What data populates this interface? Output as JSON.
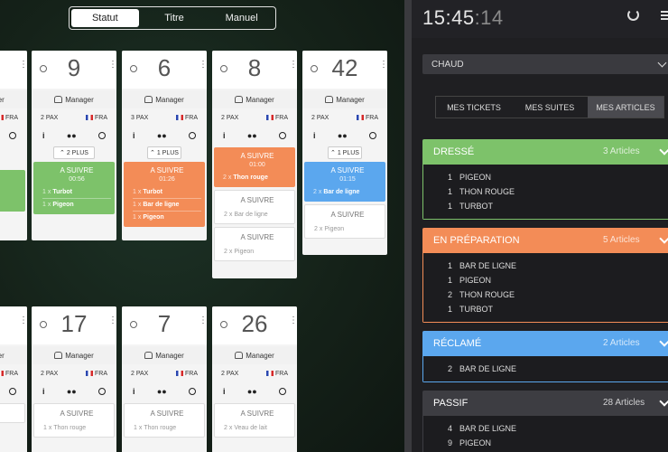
{
  "segmented": {
    "items": [
      "Statut",
      "Titre",
      "Manuel"
    ],
    "active": "Statut"
  },
  "clock": {
    "hm": "15:45",
    "sec": ":14"
  },
  "dropdown": {
    "value": "CHAUD"
  },
  "tabs": {
    "items": [
      "MES TICKETS",
      "MES SUITES",
      "MES ARTICLES"
    ],
    "active": "MES ARTICLES"
  },
  "common": {
    "manager": "Manager",
    "flag_label": "FRA",
    "info": "i",
    "menu_dots": "⋮"
  },
  "cards_row1": [
    {
      "num": "",
      "pax": "",
      "more": "",
      "blocks": [
        {
          "type": "green",
          "head": "",
          "time": "",
          "items": []
        }
      ]
    },
    {
      "num": "9",
      "pax": "2 PAX",
      "more": "2 PLUS",
      "blocks": [
        {
          "type": "green",
          "head": "A SUIVRE",
          "time": "00:56",
          "items": [
            {
              "q": "1 x",
              "n": "Turbot"
            },
            {
              "q": "1 x",
              "n": "Pigeon"
            }
          ]
        }
      ]
    },
    {
      "num": "6",
      "pax": "3 PAX",
      "more": "1 PLUS",
      "blocks": [
        {
          "type": "orange",
          "head": "A SUIVRE",
          "time": "01:26",
          "items": [
            {
              "q": "1 x",
              "n": "Turbot"
            },
            {
              "q": "1 x",
              "n": "Bar de ligne"
            },
            {
              "q": "1 x",
              "n": "Pigeon"
            }
          ]
        }
      ]
    },
    {
      "num": "8",
      "pax": "2 PAX",
      "more": "",
      "blocks": [
        {
          "type": "orange",
          "head": "A SUIVRE",
          "time": "01:00",
          "items": [
            {
              "q": "2 x",
              "n": "Thon rouge"
            }
          ]
        },
        {
          "type": "white",
          "head": "A SUIVRE",
          "items": [
            {
              "q": "2 x",
              "n": "Bar de ligne"
            }
          ]
        },
        {
          "type": "white",
          "head": "A SUIVRE",
          "items": [
            {
              "q": "2 x",
              "n": "Pigeon"
            }
          ]
        }
      ]
    },
    {
      "num": "42",
      "pax": "2 PAX",
      "more": "1 PLUS",
      "blocks": [
        {
          "type": "blue",
          "head": "A SUIVRE",
          "time": "01:15",
          "items": [
            {
              "q": "2 x",
              "n": "Bar de ligne"
            }
          ]
        },
        {
          "type": "white",
          "head": "A SUIVRE",
          "items": [
            {
              "q": "2 x",
              "n": "Pigeon"
            }
          ]
        }
      ]
    }
  ],
  "cards_row2": [
    {
      "num": "17",
      "pax": "2 PAX",
      "blocks": [
        {
          "type": "white",
          "head": "A SUIVRE",
          "items": [
            {
              "q": "1 x",
              "n": "Thon rouge"
            }
          ]
        }
      ]
    },
    {
      "num": "7",
      "pax": "2 PAX",
      "blocks": [
        {
          "type": "white",
          "head": "A SUIVRE",
          "items": [
            {
              "q": "1 x",
              "n": "Thon rouge"
            }
          ]
        }
      ]
    },
    {
      "num": "26",
      "pax": "2 PAX",
      "blocks": [
        {
          "type": "white",
          "head": "A SUIVRE",
          "items": [
            {
              "q": "2 x",
              "n": "Veau de lait"
            }
          ]
        }
      ]
    }
  ],
  "sections": [
    {
      "title": "DRESSÉ",
      "count": "3 Articles",
      "color": "green",
      "items": [
        {
          "q": "1",
          "n": "PIGEON"
        },
        {
          "q": "1",
          "n": "THON ROUGE"
        },
        {
          "q": "1",
          "n": "TURBOT"
        }
      ]
    },
    {
      "title": "EN PRÉPARATION",
      "count": "5 Articles",
      "color": "orange",
      "items": [
        {
          "q": "1",
          "n": "BAR DE LIGNE"
        },
        {
          "q": "1",
          "n": "PIGEON"
        },
        {
          "q": "2",
          "n": "THON ROUGE"
        },
        {
          "q": "1",
          "n": "TURBOT"
        }
      ]
    },
    {
      "title": "RÉCLAMÉ",
      "count": "2 Articles",
      "color": "blue",
      "items": [
        {
          "q": "2",
          "n": "BAR DE LIGNE"
        }
      ]
    },
    {
      "title": "PASSIF",
      "count": "28 Articles",
      "color": "grey",
      "items": [
        {
          "q": "4",
          "n": "BAR DE LIGNE"
        },
        {
          "q": "9",
          "n": "PIGEON"
        }
      ]
    }
  ]
}
